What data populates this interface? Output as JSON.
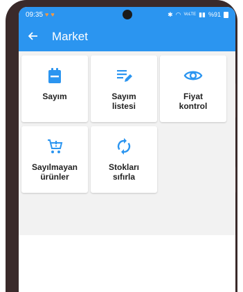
{
  "status": {
    "time": "09:35",
    "battery": "%91",
    "signal_text": "VoLTE"
  },
  "appbar": {
    "title": "Market"
  },
  "colors": {
    "primary": "#2b95f0",
    "icon": "#2b95f0"
  },
  "tiles": [
    {
      "label": "Sayım",
      "icon": "clipboard-icon"
    },
    {
      "label": "Sayım\nlistesi",
      "icon": "list-edit-icon"
    },
    {
      "label": "Fiyat\nkontrol",
      "icon": "eye-icon"
    },
    {
      "label": "Sayılmayan\nürünler",
      "icon": "cart-icon"
    },
    {
      "label": "Stokları\nsıfırla",
      "icon": "sync-icon"
    }
  ]
}
